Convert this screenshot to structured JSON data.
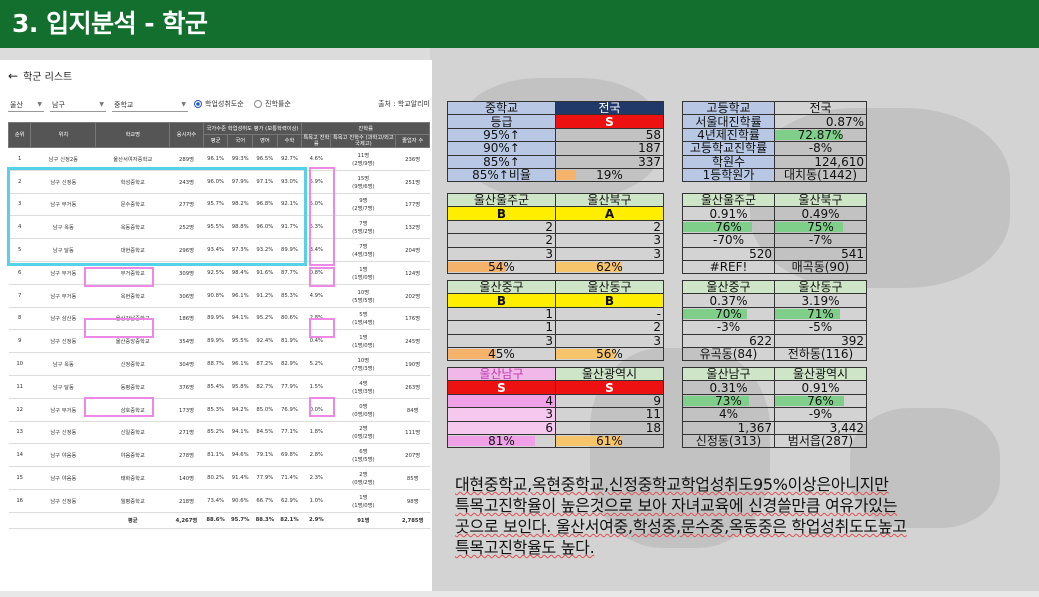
{
  "page_title": "3. 입지분석 - 학군",
  "left": {
    "back_label": "학군 리스트",
    "filters": {
      "region": "울산",
      "district": "남구",
      "level": "중학교",
      "radio1": "학업성취도순",
      "radio2": "진학률순",
      "source": "출처 : 학교알리미"
    },
    "headers": {
      "rank": "순위",
      "location": "위치",
      "name": "학교명",
      "applicants": "응시자수",
      "group_eval": "국가수준 학업성취도 평가 (보통학력이상)",
      "avg": "평균",
      "kor": "국어",
      "eng": "영어",
      "math": "수학",
      "group_adv": "진학률",
      "special": "특목고 진학률",
      "special_detail": "특목고 진학수 (과학고/외고국제고)",
      "grads": "졸업자 수"
    },
    "rows": [
      {
        "rank": "1",
        "loc": "남구 신정2동",
        "name": "울산서여자중학교",
        "n": "289명",
        "avg": "96.1%",
        "kor": "99.3%",
        "eng": "96.5%",
        "math": "92.7%",
        "sp": "4.6%",
        "cnt": "11명",
        "det": "(2명/9명)",
        "grad": "236명"
      },
      {
        "rank": "2",
        "loc": "남구 신정동",
        "name": "학성중학교",
        "n": "243명",
        "avg": "96.0%",
        "kor": "97.9%",
        "eng": "97.1%",
        "math": "93.0%",
        "sp": "5.9%",
        "cnt": "15명",
        "det": "(9명/6명)",
        "grad": "251명"
      },
      {
        "rank": "3",
        "loc": "남구 무거동",
        "name": "문수중학교",
        "n": "277명",
        "avg": "95.7%",
        "kor": "98.2%",
        "eng": "96.8%",
        "math": "92.1%",
        "sp": "5.0%",
        "cnt": "9명",
        "det": "(2명/7명)",
        "grad": "177명"
      },
      {
        "rank": "4",
        "loc": "남구 옥동",
        "name": "옥동중학교",
        "n": "252명",
        "avg": "95.5%",
        "kor": "98.8%",
        "eng": "96.0%",
        "math": "91.7%",
        "sp": "5.3%",
        "cnt": "7명",
        "det": "(5명/2명)",
        "grad": "132명"
      },
      {
        "rank": "5",
        "loc": "남구 달동",
        "name": "대현중학교",
        "n": "296명",
        "avg": "93.4%",
        "kor": "97.3%",
        "eng": "93.2%",
        "math": "89.9%",
        "sp": "3.4%",
        "cnt": "7명",
        "det": "(4명/3명)",
        "grad": "204명"
      },
      {
        "rank": "6",
        "loc": "남구 무거동",
        "name": "무거중학교",
        "n": "309명",
        "avg": "92.5%",
        "kor": "98.4%",
        "eng": "91.6%",
        "math": "87.7%",
        "sp": "0.8%",
        "cnt": "1명",
        "det": "(1명/0명)",
        "grad": "124명"
      },
      {
        "rank": "7",
        "loc": "남구 무거동",
        "name": "옥현중학교",
        "n": "306명",
        "avg": "90.8%",
        "kor": "96.1%",
        "eng": "91.2%",
        "math": "85.3%",
        "sp": "4.9%",
        "cnt": "10명",
        "det": "(5명/5명)",
        "grad": "202명"
      },
      {
        "rank": "8",
        "loc": "남구 삼산동",
        "name": "울산강남중학교",
        "n": "186명",
        "avg": "89.9%",
        "kor": "94.1%",
        "eng": "95.2%",
        "math": "80.6%",
        "sp": "2.8%",
        "cnt": "5명",
        "det": "(1명/4명)",
        "grad": "176명"
      },
      {
        "rank": "9",
        "loc": "남구 신정동",
        "name": "울산중앙중학교",
        "n": "354명",
        "avg": "89.9%",
        "kor": "95.5%",
        "eng": "92.4%",
        "math": "81.9%",
        "sp": "0.4%",
        "cnt": "1명",
        "det": "(1명/0명)",
        "grad": "245명"
      },
      {
        "rank": "10",
        "loc": "남구 옥동",
        "name": "신정중학교",
        "n": "304명",
        "avg": "88.7%",
        "kor": "96.1%",
        "eng": "87.2%",
        "math": "82.9%",
        "sp": "5.2%",
        "cnt": "10명",
        "det": "(7명/3명)",
        "grad": "190명"
      },
      {
        "rank": "11",
        "loc": "남구 달동",
        "name": "동평중학교",
        "n": "376명",
        "avg": "85.4%",
        "kor": "95.8%",
        "eng": "82.7%",
        "math": "77.9%",
        "sp": "1.5%",
        "cnt": "4명",
        "det": "(1명/3명)",
        "grad": "263명"
      },
      {
        "rank": "12",
        "loc": "남구 무거동",
        "name": "삼호중학교",
        "n": "173명",
        "avg": "85.3%",
        "kor": "94.2%",
        "eng": "85.0%",
        "math": "76.9%",
        "sp": "0.0%",
        "cnt": "0명",
        "det": "(0명/0명)",
        "grad": "84명"
      },
      {
        "rank": "13",
        "loc": "남구 신정동",
        "name": "신일중학교",
        "n": "271명",
        "avg": "85.2%",
        "kor": "94.1%",
        "eng": "84.5%",
        "math": "77.1%",
        "sp": "1.8%",
        "cnt": "2명",
        "det": "(0명/2명)",
        "grad": "111명"
      },
      {
        "rank": "14",
        "loc": "남구 야음동",
        "name": "야음중학교",
        "n": "278명",
        "avg": "81.1%",
        "kor": "94.6%",
        "eng": "79.1%",
        "math": "69.8%",
        "sp": "2.8%",
        "cnt": "6명",
        "det": "(1명/5명)",
        "grad": "207명"
      },
      {
        "rank": "15",
        "loc": "남구 야음동",
        "name": "태화중학교",
        "n": "140명",
        "avg": "80.2%",
        "kor": "91.4%",
        "eng": "77.9%",
        "math": "71.4%",
        "sp": "2.3%",
        "cnt": "2명",
        "det": "(0명/2명)",
        "grad": "85명"
      },
      {
        "rank": "16",
        "loc": "남구 신정동",
        "name": "월평중학교",
        "n": "218명",
        "avg": "73.4%",
        "kor": "90.6%",
        "eng": "66.7%",
        "math": "62.9%",
        "sp": "1.0%",
        "cnt": "1명",
        "det": "(1명/0명)",
        "grad": "98명"
      }
    ],
    "footer": {
      "label": "평균",
      "n": "4,267명",
      "avg": "88.6%",
      "kor": "95.7%",
      "eng": "88.3%",
      "math": "82.1%",
      "sp": "2.9%",
      "cnt": "91명",
      "grad": "2,785명"
    }
  },
  "middle": {
    "top": {
      "c1": "중학교",
      "c2": "전국",
      "r1": "등급",
      "r1v": "S",
      "rows": [
        [
          "95%↑",
          "58"
        ],
        [
          "90%↑",
          "187"
        ],
        [
          "85%↑",
          "337"
        ]
      ],
      "last": [
        "85%↑비율",
        "19%"
      ],
      "last_pct": 19
    },
    "blocks": [
      {
        "a_name": "울산울주군",
        "b_name": "울산북구",
        "a_grade": "B",
        "b_grade": "A",
        "a_vals": [
          "2",
          "2",
          "3"
        ],
        "b_vals": [
          "2",
          "3",
          "3"
        ],
        "a_pct": "54%",
        "b_pct": "62%",
        "a_pct_v": 54,
        "b_pct_v": 62
      },
      {
        "a_name": "울산중구",
        "b_name": "울산동구",
        "a_grade": "B",
        "b_grade": "B",
        "a_vals": [
          "1",
          "1",
          "3"
        ],
        "b_vals": [
          "-",
          "2",
          "3"
        ],
        "a_pct": "45%",
        "b_pct": "56%",
        "a_pct_v": 45,
        "b_pct_v": 56
      },
      {
        "a_name": "울산남구",
        "b_name": "울산광역시",
        "a_grade": "S",
        "b_grade": "S",
        "a_vals": [
          "4",
          "3",
          "6"
        ],
        "b_vals": [
          "9",
          "11",
          "18"
        ],
        "a_pct": "81%",
        "b_pct": "61%",
        "a_pct_v": 81,
        "b_pct_v": 61
      }
    ]
  },
  "right": {
    "top": {
      "c1": "고등학교",
      "c2": "전국",
      "rows": [
        [
          "서울대진학률",
          "0.87%"
        ],
        [
          "4년제진학률",
          "72.87%"
        ],
        [
          "고등학교진학률",
          "-8%"
        ],
        [
          "학원수",
          "124,610"
        ],
        [
          "1등학원가",
          "대치동(1442)"
        ]
      ],
      "uni_pct": 72.87
    },
    "blocks": [
      {
        "a_name": "울산울주군",
        "b_name": "울산북구",
        "a": [
          "0.91%",
          "76%",
          "-70%",
          "520",
          "#REF!"
        ],
        "b": [
          "0.49%",
          "75%",
          "-7%",
          "541",
          "매곡동(90)"
        ],
        "a_uni": 76,
        "b_uni": 75
      },
      {
        "a_name": "울산중구",
        "b_name": "울산동구",
        "a": [
          "0.37%",
          "70%",
          "-3%",
          "622",
          "유곡동(84)"
        ],
        "b": [
          "3.19%",
          "71%",
          "-5%",
          "392",
          "전하동(116)"
        ],
        "a_uni": 70,
        "b_uni": 71
      },
      {
        "a_name": "울산남구",
        "b_name": "울산광역시",
        "a": [
          "0.31%",
          "73%",
          "4%",
          "1,367",
          "신정동(313)"
        ],
        "b": [
          "0.91%",
          "76%",
          "-9%",
          "3,442",
          "범서읍(287)"
        ],
        "a_uni": 73,
        "b_uni": 76
      }
    ]
  },
  "note": {
    "line1": "대현중학교,옥현중학교,신정중학교학업성취도95%이상은아니지만",
    "line2": "특목고진학율이 높은것으로 보아 자녀교육에 신경쓸만큼 여유가있는",
    "line3": "곳으로 보인다. 울산서여중,학성중,문수중,옥동중은 학업성취도도높고",
    "line4": "특목고진학율도 높다."
  },
  "colors": {
    "header_green": "#136f2e",
    "grade_red": "#ee1111",
    "grade_yellow": "#ffee00",
    "highlight_cyan": "#55d2e8",
    "highlight_pink": "#ee88e6"
  }
}
